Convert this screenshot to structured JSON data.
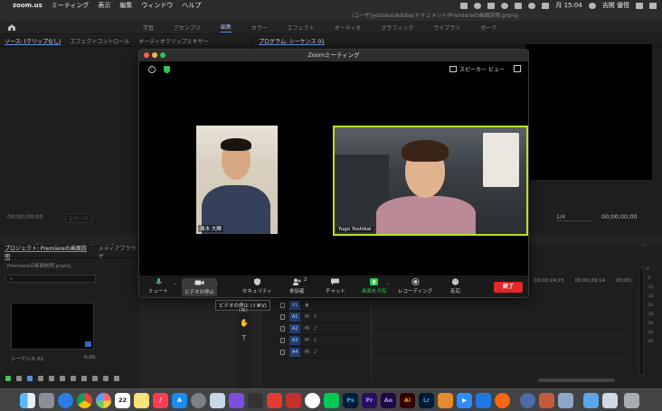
{
  "menubar": {
    "app_name": "zoom.us",
    "menus": [
      "ミーティング",
      "表示",
      "編集",
      "ウィンドウ",
      "ヘルプ"
    ],
    "clock": "月 15:04",
    "user": "吉開 優悟"
  },
  "premiere": {
    "title": "/ユーザ/yoshikai/Adobe/ドキュメント/Premiereの画面説明.prproj",
    "workspaces": [
      "学習",
      "アセンブリ",
      "編集",
      "カラー",
      "エフェクト",
      "オーディオ",
      "グラフィック",
      "ライブラリ",
      "ボーク"
    ],
    "active_workspace": "編集",
    "source_tabs": [
      "ソース: (クリップなし)",
      "エフェクトコントロール",
      "オーディオクリップミキサー"
    ],
    "program_tab": "プログラム: シーケンス 01",
    "source_timecode": "00;00;00;00",
    "source_page": "1ページ",
    "program_fit": "1/4",
    "program_timecode": "00;00;00;00",
    "project_tabs": [
      "プロジェクト: Premiereの画面説明",
      "メディアブラウザ"
    ],
    "project_file": "Premiereの画面説明.prproj",
    "clip_name": "シーケンス 01",
    "clip_duration": "0;00",
    "timeline_times": [
      "00;00;24;23",
      "00;00;29;14",
      "00;00;33;1"
    ],
    "tracks": [
      {
        "name": "V1",
        "type": "video"
      },
      {
        "name": "A1",
        "type": "audio"
      },
      {
        "name": "A2",
        "type": "audio"
      },
      {
        "name": "A3",
        "type": "audio"
      },
      {
        "name": "A4",
        "type": "audio"
      }
    ],
    "meter_scale": [
      "0",
      "-6",
      "-12",
      "-18",
      "-24",
      "-30",
      "-36",
      "-42",
      "-48"
    ]
  },
  "zoom": {
    "window_title": "Zoomミーティング",
    "speaker_view": "スピーカー ビュー",
    "participants": [
      {
        "name": "清水 大輝"
      },
      {
        "name": "Yugo  Yoshikai"
      }
    ],
    "toolbar": {
      "mute": "ミュート",
      "video_stop": "ビデオの停止",
      "security": "セキュリティ",
      "participants": "参加者",
      "participants_count": "2",
      "chat": "チャット",
      "share": "画面を共有",
      "record": "レコーディング",
      "reaction": "反応",
      "end": "終了"
    },
    "tooltip": "ビデオの停止 (⇧⌘V)",
    "tooltip_sub": "(⌘)"
  },
  "dock": {
    "apps": [
      "Finder",
      "Launchpad",
      "Safari",
      "Chrome",
      "Photos",
      "Calendar",
      "Notes",
      "Music",
      "App Store",
      "System Preferences",
      "Photos2",
      "Final Cut",
      "Creative Cloud",
      "Reeder",
      "LINE",
      "Acrobat",
      "Photoshop",
      "Premiere Pro",
      "After Effects",
      "Illustrator",
      "Lightroom",
      "Other",
      "Zoom",
      "Finder2",
      "Firefox",
      "Migration",
      "Chrome2",
      "Image",
      "Downloads",
      "Folder",
      "Trash"
    ],
    "colors": {
      "ps": "#001e36",
      "pr": "#2a0d5e",
      "ae": "#1f0740",
      "ai": "#330000",
      "lr": "#001a33",
      "zoom": "#2d8cff"
    }
  }
}
